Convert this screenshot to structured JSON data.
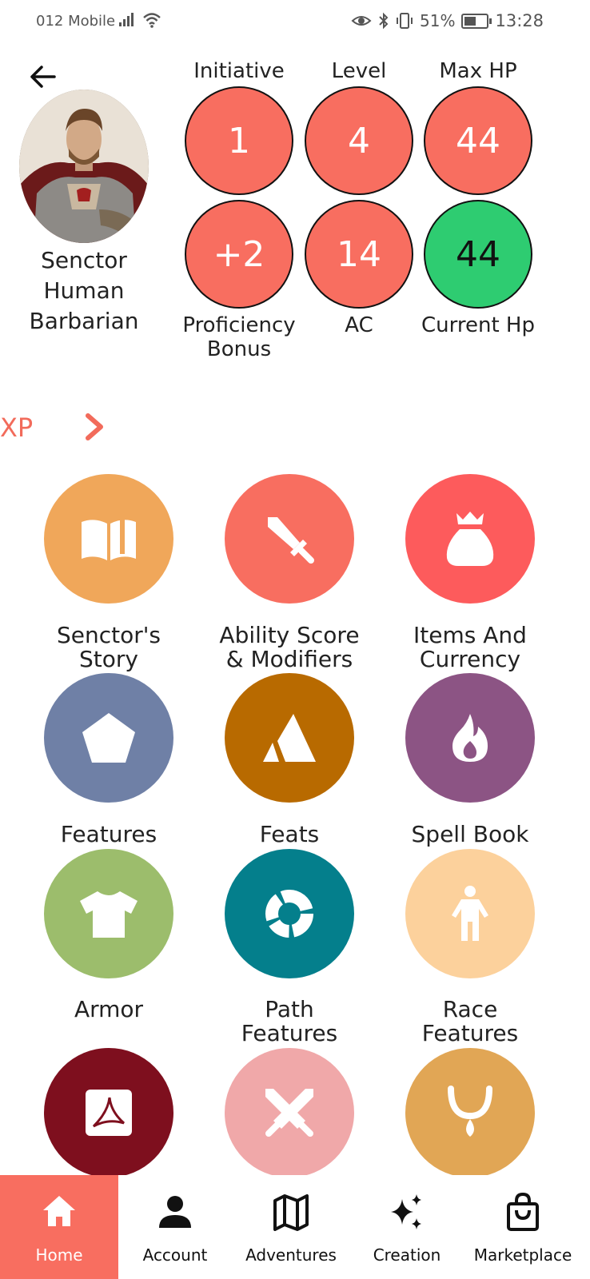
{
  "status_bar": {
    "carrier": "012 Mobile",
    "battery": "51%",
    "time": "13:28"
  },
  "character": {
    "name": "Senctor",
    "race": "Human",
    "class": "Barbarian"
  },
  "stats": {
    "initiative": {
      "label": "Initiative",
      "value": "1"
    },
    "level": {
      "label": "Level",
      "value": "4"
    },
    "max_hp": {
      "label": "Max HP",
      "value": "44"
    },
    "proficiency": {
      "label_1": "Proficiency",
      "label_2": "Bonus",
      "value": "+2"
    },
    "ac": {
      "label": "AC",
      "value": "14"
    },
    "current_hp": {
      "label": "Current Hp",
      "value": "44"
    }
  },
  "xp_label": "XP",
  "tiles": [
    {
      "line1": "Senctor's",
      "line2": "Story",
      "icon": "book-icon",
      "color": "#f0a75a"
    },
    {
      "line1": "Ability Score",
      "line2": "& Modifiers",
      "icon": "sword-icon",
      "color": "#f86e60"
    },
    {
      "line1": "Items And",
      "line2": "Currency",
      "icon": "money-bag-icon",
      "color": "#fd5b5c"
    },
    {
      "line1": "Features",
      "line2": "",
      "icon": "pentagon-icon",
      "color": "#6f80a6"
    },
    {
      "line1": "Feats",
      "line2": "",
      "icon": "mountain-icon",
      "color": "#b86a00"
    },
    {
      "line1": "Spell Book",
      "line2": "",
      "icon": "flame-icon",
      "color": "#8c5484"
    },
    {
      "line1": "Armor",
      "line2": "",
      "icon": "shirt-icon",
      "color": "#9cbd6c"
    },
    {
      "line1": "Path",
      "line2": "Features",
      "icon": "donut-chart-icon",
      "color": "#047f8c"
    },
    {
      "line1": "Race",
      "line2": "Features",
      "icon": "person-icon",
      "color": "#fcd19c"
    },
    {
      "icon": "pdf-icon",
      "color": "#7e0f1e"
    },
    {
      "icon": "crossed-swords-icon",
      "color": "#f0a8a9"
    },
    {
      "icon": "amulet-icon",
      "color": "#e1a655"
    }
  ],
  "nav": [
    {
      "label": "Home",
      "icon": "home-icon",
      "active": true
    },
    {
      "label": "Account",
      "icon": "account-icon"
    },
    {
      "label": "Adventures",
      "icon": "map-icon"
    },
    {
      "label": "Creation",
      "icon": "sparkles-icon"
    },
    {
      "label": "Marketplace",
      "icon": "shopping-bag-icon"
    }
  ]
}
